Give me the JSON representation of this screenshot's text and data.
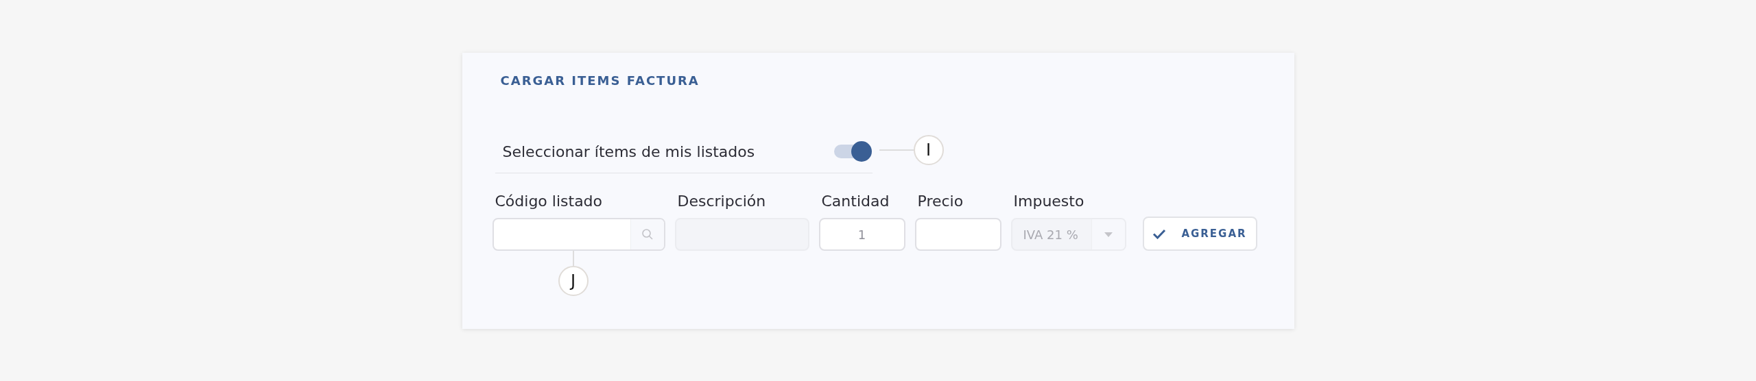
{
  "card": {
    "title": "CARGAR ITEMS FACTURA"
  },
  "toggle": {
    "label": "Seleccionar ítems de mis listados",
    "on": true,
    "marker": "I"
  },
  "fields": [
    {
      "kind": "search",
      "label": "Código listado",
      "disabled": false,
      "marker": "J"
    },
    {
      "kind": "text",
      "label": "Descripción",
      "disabled": true
    },
    {
      "kind": "number",
      "label": "Cantidad",
      "value": "1",
      "disabled": false
    },
    {
      "kind": "text",
      "label": "Precio",
      "disabled": false
    },
    {
      "kind": "select",
      "label": "Impuesto",
      "value": "IVA 21 %",
      "disabled": true
    }
  ],
  "button": {
    "label": "AGREGAR"
  }
}
